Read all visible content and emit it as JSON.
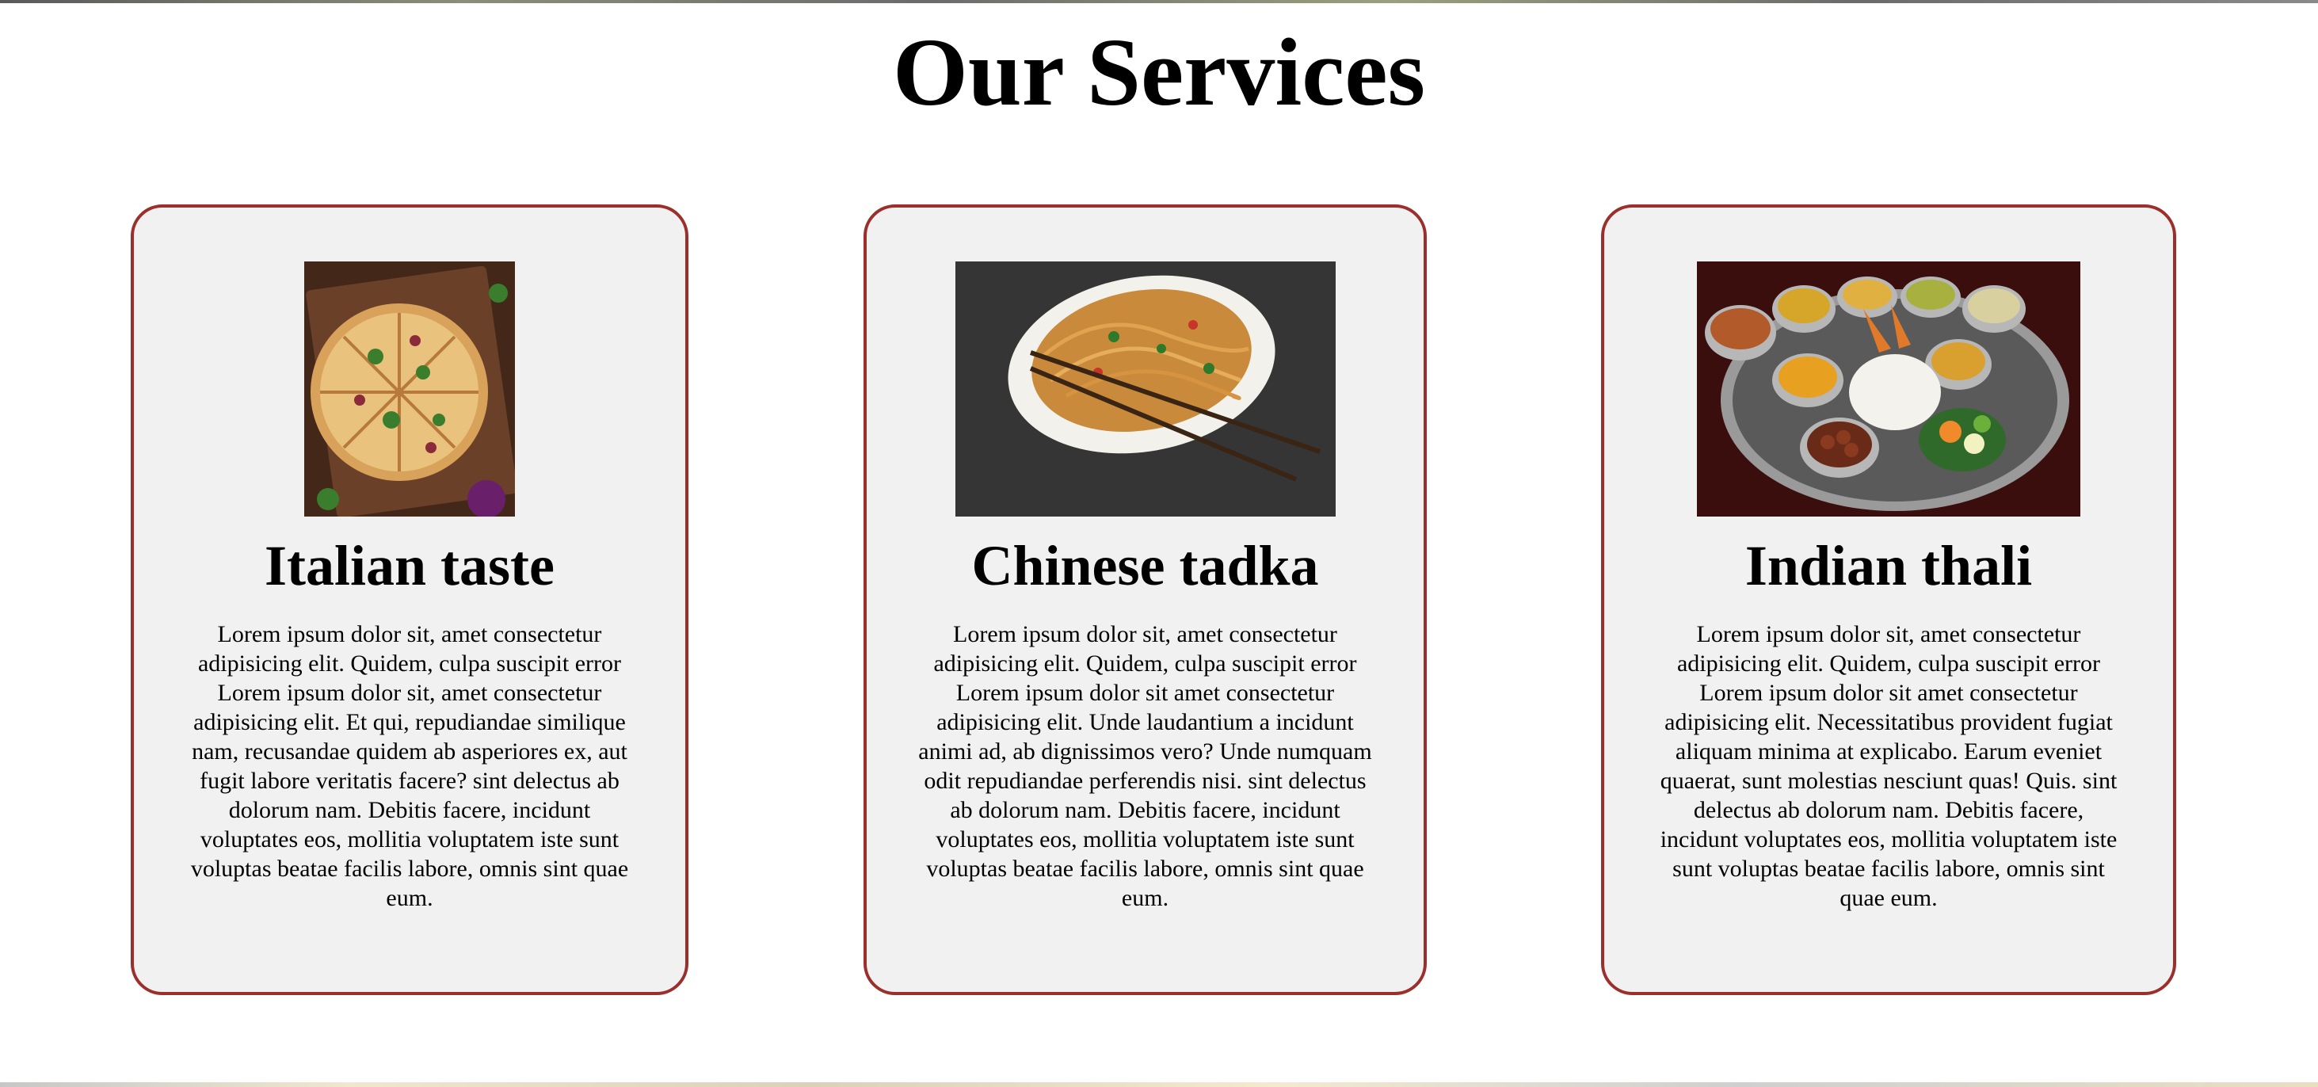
{
  "page": {
    "title": "Our Services"
  },
  "services": [
    {
      "title": "Italian taste",
      "image": "pizza-image",
      "description": "Lorem ipsum dolor sit, amet consectetur adipisicing elit. Quidem, culpa suscipit error Lorem ipsum dolor sit, amet consectetur adipisicing elit. Et qui, repudiandae similique nam, recusandae quidem ab asperiores ex, aut fugit labore veritatis facere? sint delectus ab dolorum nam. Debitis facere, incidunt voluptates eos, mollitia voluptatem iste sunt voluptas beatae facilis labore, omnis sint quae eum."
    },
    {
      "title": "Chinese tadka",
      "image": "noodles-image",
      "description": "Lorem ipsum dolor sit, amet consectetur adipisicing elit. Quidem, culpa suscipit error Lorem ipsum dolor sit amet consectetur adipisicing elit. Unde laudantium a incidunt animi ad, ab dignissimos vero? Unde numquam odit repudiandae perferendis nisi. sint delectus ab dolorum nam. Debitis facere, incidunt voluptates eos, mollitia voluptatem iste sunt voluptas beatae facilis labore, omnis sint quae eum."
    },
    {
      "title": "Indian thali",
      "image": "thali-image",
      "description": "Lorem ipsum dolor sit, amet consectetur adipisicing elit. Quidem, culpa suscipit error Lorem ipsum dolor sit amet consectetur adipisicing elit. Necessitatibus provident fugiat aliquam minima at explicabo. Earum eveniet quaerat, sunt molestias nesciunt quas! Quis. sint delectus ab dolorum nam. Debitis facere, incidunt voluptates eos, mollitia voluptatem iste sunt voluptas beatae facilis labore, omnis sint quae eum."
    }
  ],
  "colors": {
    "card_border": "#9b2f2c",
    "card_background": "#f1f1f1",
    "page_background": "#ffffff"
  }
}
